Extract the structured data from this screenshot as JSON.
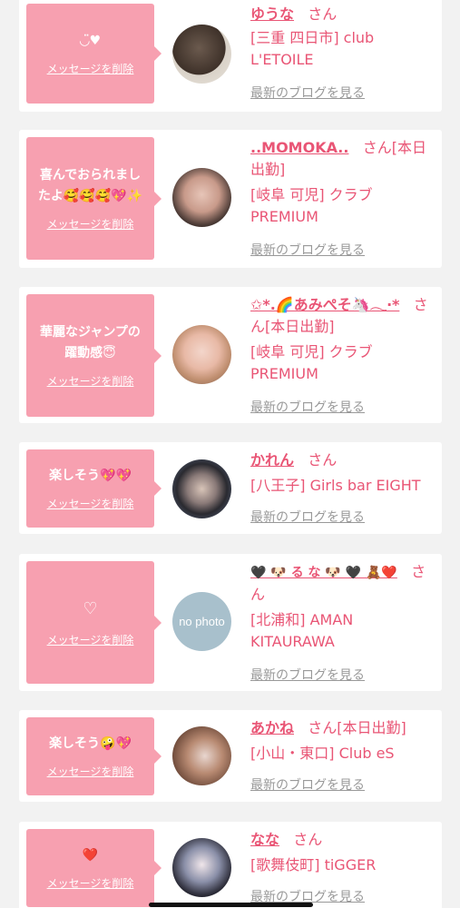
{
  "cards": [
    {
      "message": "◡̈♥",
      "delete_label": "メッセージを削除",
      "name": "ゆうな",
      "san": "さん",
      "shop": "[三重 四日市] club L'ETOILE",
      "blog_label": "最新のブログを見る"
    },
    {
      "message": "喜んでおられましたよ🥰🥰🥰💖✨",
      "delete_label": "メッセージを削除",
      "name": "..MOMOKA..",
      "san": "さん[本日出勤]",
      "shop": "[岐阜 可児] クラブ PREMIUM",
      "blog_label": "最新のブログを見る"
    },
    {
      "message": "華麗なジャンプの躍動感😇",
      "delete_label": "メッセージを削除",
      "name": "✩*.🌈あみぺそ🦄𓂃‧*",
      "san": "さん[本日出勤]",
      "shop": "[岐阜 可児] クラブ PREMIUM",
      "blog_label": "最新のブログを見る"
    },
    {
      "message": "楽しそう💖💖",
      "delete_label": "メッセージを削除",
      "name": "かれん",
      "san": "さん",
      "shop": "[八王子] Girls bar EIGHT",
      "blog_label": "最新のブログを見る"
    },
    {
      "message": "♡",
      "delete_label": "メッセージを削除",
      "name": "🖤 🐶 る な 🐶 🖤 🧸❤️",
      "san": "さん",
      "shop": "[北浦和] AMAN KITAURAWA",
      "blog_label": "最新のブログを見る",
      "avatar_text": "no photo"
    },
    {
      "message": "楽しそう🤪💖",
      "delete_label": "メッセージを削除",
      "name": "あかね",
      "san": "さん[本日出勤]",
      "shop": "[小山・東口] Club eS",
      "blog_label": "最新のブログを見る"
    },
    {
      "message": "❤️",
      "delete_label": "メッセージを削除",
      "name": "なな",
      "san": "さん",
      "shop": "[歌舞伎町] tiGGER",
      "blog_label": "最新のブログを見る"
    }
  ],
  "colors": {
    "bubble": "#f7a0b0",
    "name": "#e95575",
    "blog_link": "#999999",
    "background": "#f2f2f2"
  }
}
